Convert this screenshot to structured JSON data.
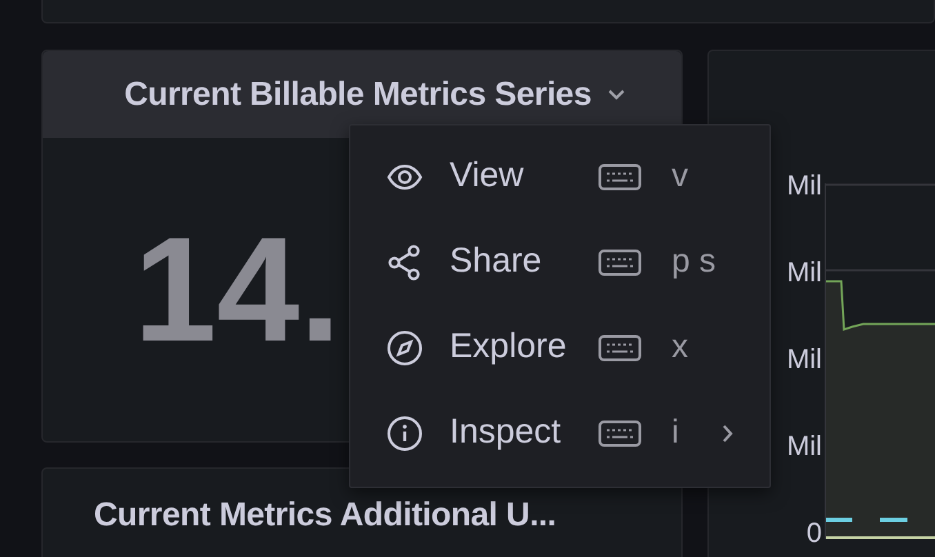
{
  "panels": [
    {
      "title": "Current Billable Metrics Series",
      "value": "14.",
      "header_highlighted": true
    },
    {
      "title": "Current Metrics Additional U..."
    }
  ],
  "chart_panel": {
    "y_axis_labels": [
      "Mil",
      "Mil",
      "Mil",
      "Mil",
      "0"
    ]
  },
  "context_menu": {
    "items": [
      {
        "kind": "view",
        "label": "View",
        "shortcut": "v",
        "has_submenu": false
      },
      {
        "kind": "share",
        "label": "Share",
        "shortcut": "p s",
        "has_submenu": false
      },
      {
        "kind": "explore",
        "label": "Explore",
        "shortcut": "x",
        "has_submenu": false
      },
      {
        "kind": "inspect",
        "label": "Inspect",
        "shortcut": "i",
        "has_submenu": true
      }
    ]
  }
}
